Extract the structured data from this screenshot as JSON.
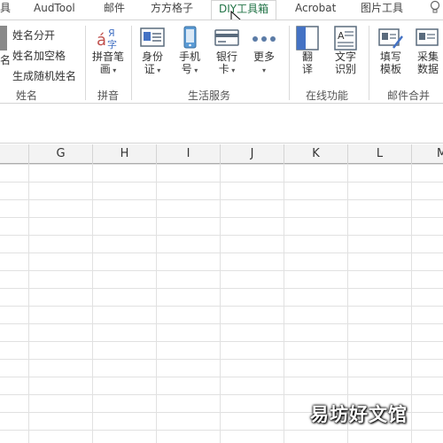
{
  "tabs": [
    {
      "label": "具"
    },
    {
      "label": "AudTool"
    },
    {
      "label": "邮件"
    },
    {
      "label": "方方格子"
    },
    {
      "label": "DIY工具箱",
      "active": true
    },
    {
      "label": "Acrobat"
    },
    {
      "label": "图片工具"
    }
  ],
  "help_icon": "lightbulb-icon",
  "accent_color": "#217346",
  "ribbon": {
    "name_group": {
      "partial_label": "名",
      "items": [
        "姓名分开",
        "姓名加空格",
        "生成随机姓名"
      ],
      "label": "姓名"
    },
    "pinyin_group": {
      "button_line1": "拼音笔",
      "button_line2": "画",
      "label": "拼音"
    },
    "life_group": {
      "buttons": [
        {
          "line1": "身份",
          "line2": "证"
        },
        {
          "line1": "手机",
          "line2": "号"
        },
        {
          "line1": "银行",
          "line2": "卡"
        },
        {
          "line1": "更多",
          "line2": ""
        }
      ],
      "label": "生活服务"
    },
    "online_group": {
      "buttons": [
        {
          "line1": "翻",
          "line2": "译"
        },
        {
          "line1": "文字",
          "line2": "识别"
        }
      ],
      "label": "在线功能"
    },
    "mail_group": {
      "buttons": [
        {
          "line1": "填写",
          "line2": "模板"
        },
        {
          "line1": "采集",
          "line2": "数据"
        }
      ],
      "label": "邮件合并"
    }
  },
  "columns": [
    "G",
    "H",
    "I",
    "J",
    "K",
    "L",
    "M"
  ],
  "watermark": "易坊好文馆"
}
